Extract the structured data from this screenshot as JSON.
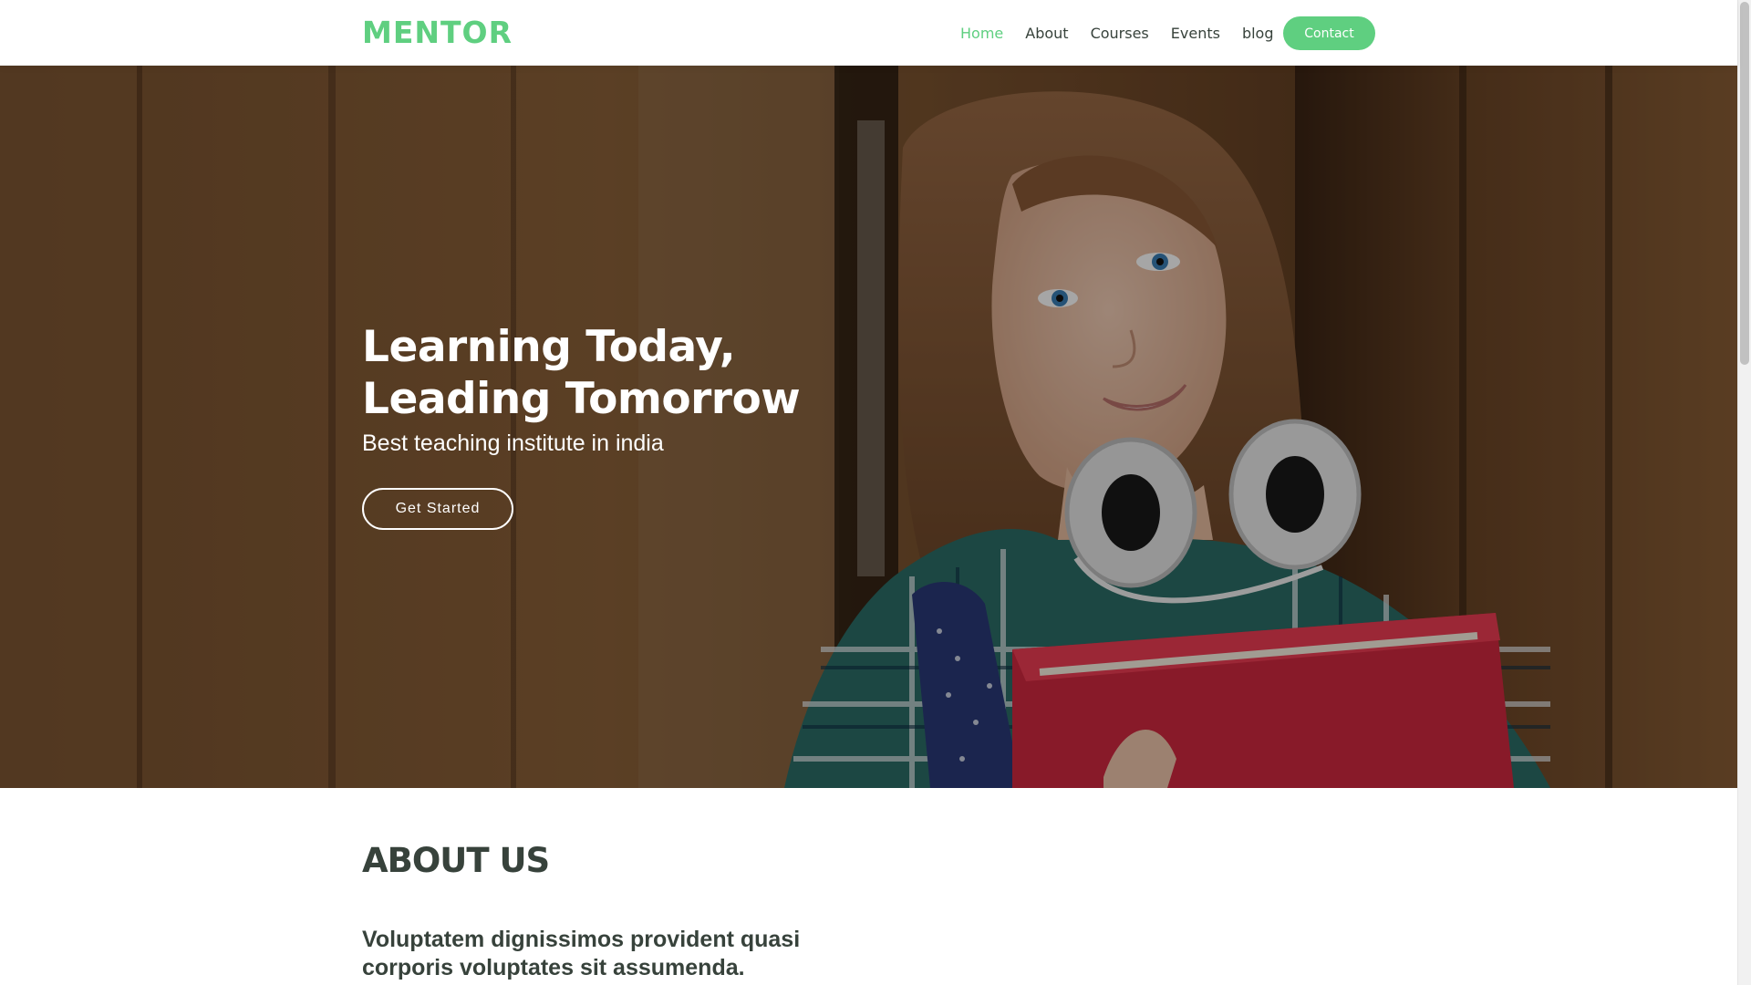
{
  "header": {
    "logo": "MENTOR",
    "nav": [
      {
        "label": "Home",
        "active": true
      },
      {
        "label": "About",
        "active": false
      },
      {
        "label": "Courses",
        "active": false
      },
      {
        "label": "Events",
        "active": false
      },
      {
        "label": "blog",
        "active": false
      }
    ],
    "contact_label": "Contact"
  },
  "hero": {
    "title_line1": "Learning Today,",
    "title_line2": "Leading Tomorrow",
    "subtitle": "Best teaching institute in india",
    "cta_label": "Get Started"
  },
  "about": {
    "title": "ABOUT US",
    "lead": "Voluptatem dignissimos provident quasi corporis voluptates sit assumenda."
  },
  "colors": {
    "accent": "#5fcf80",
    "text_dark": "#37423b",
    "white": "#ffffff"
  },
  "icons": {
    "scrollbar": "vertical-scrollbar"
  }
}
